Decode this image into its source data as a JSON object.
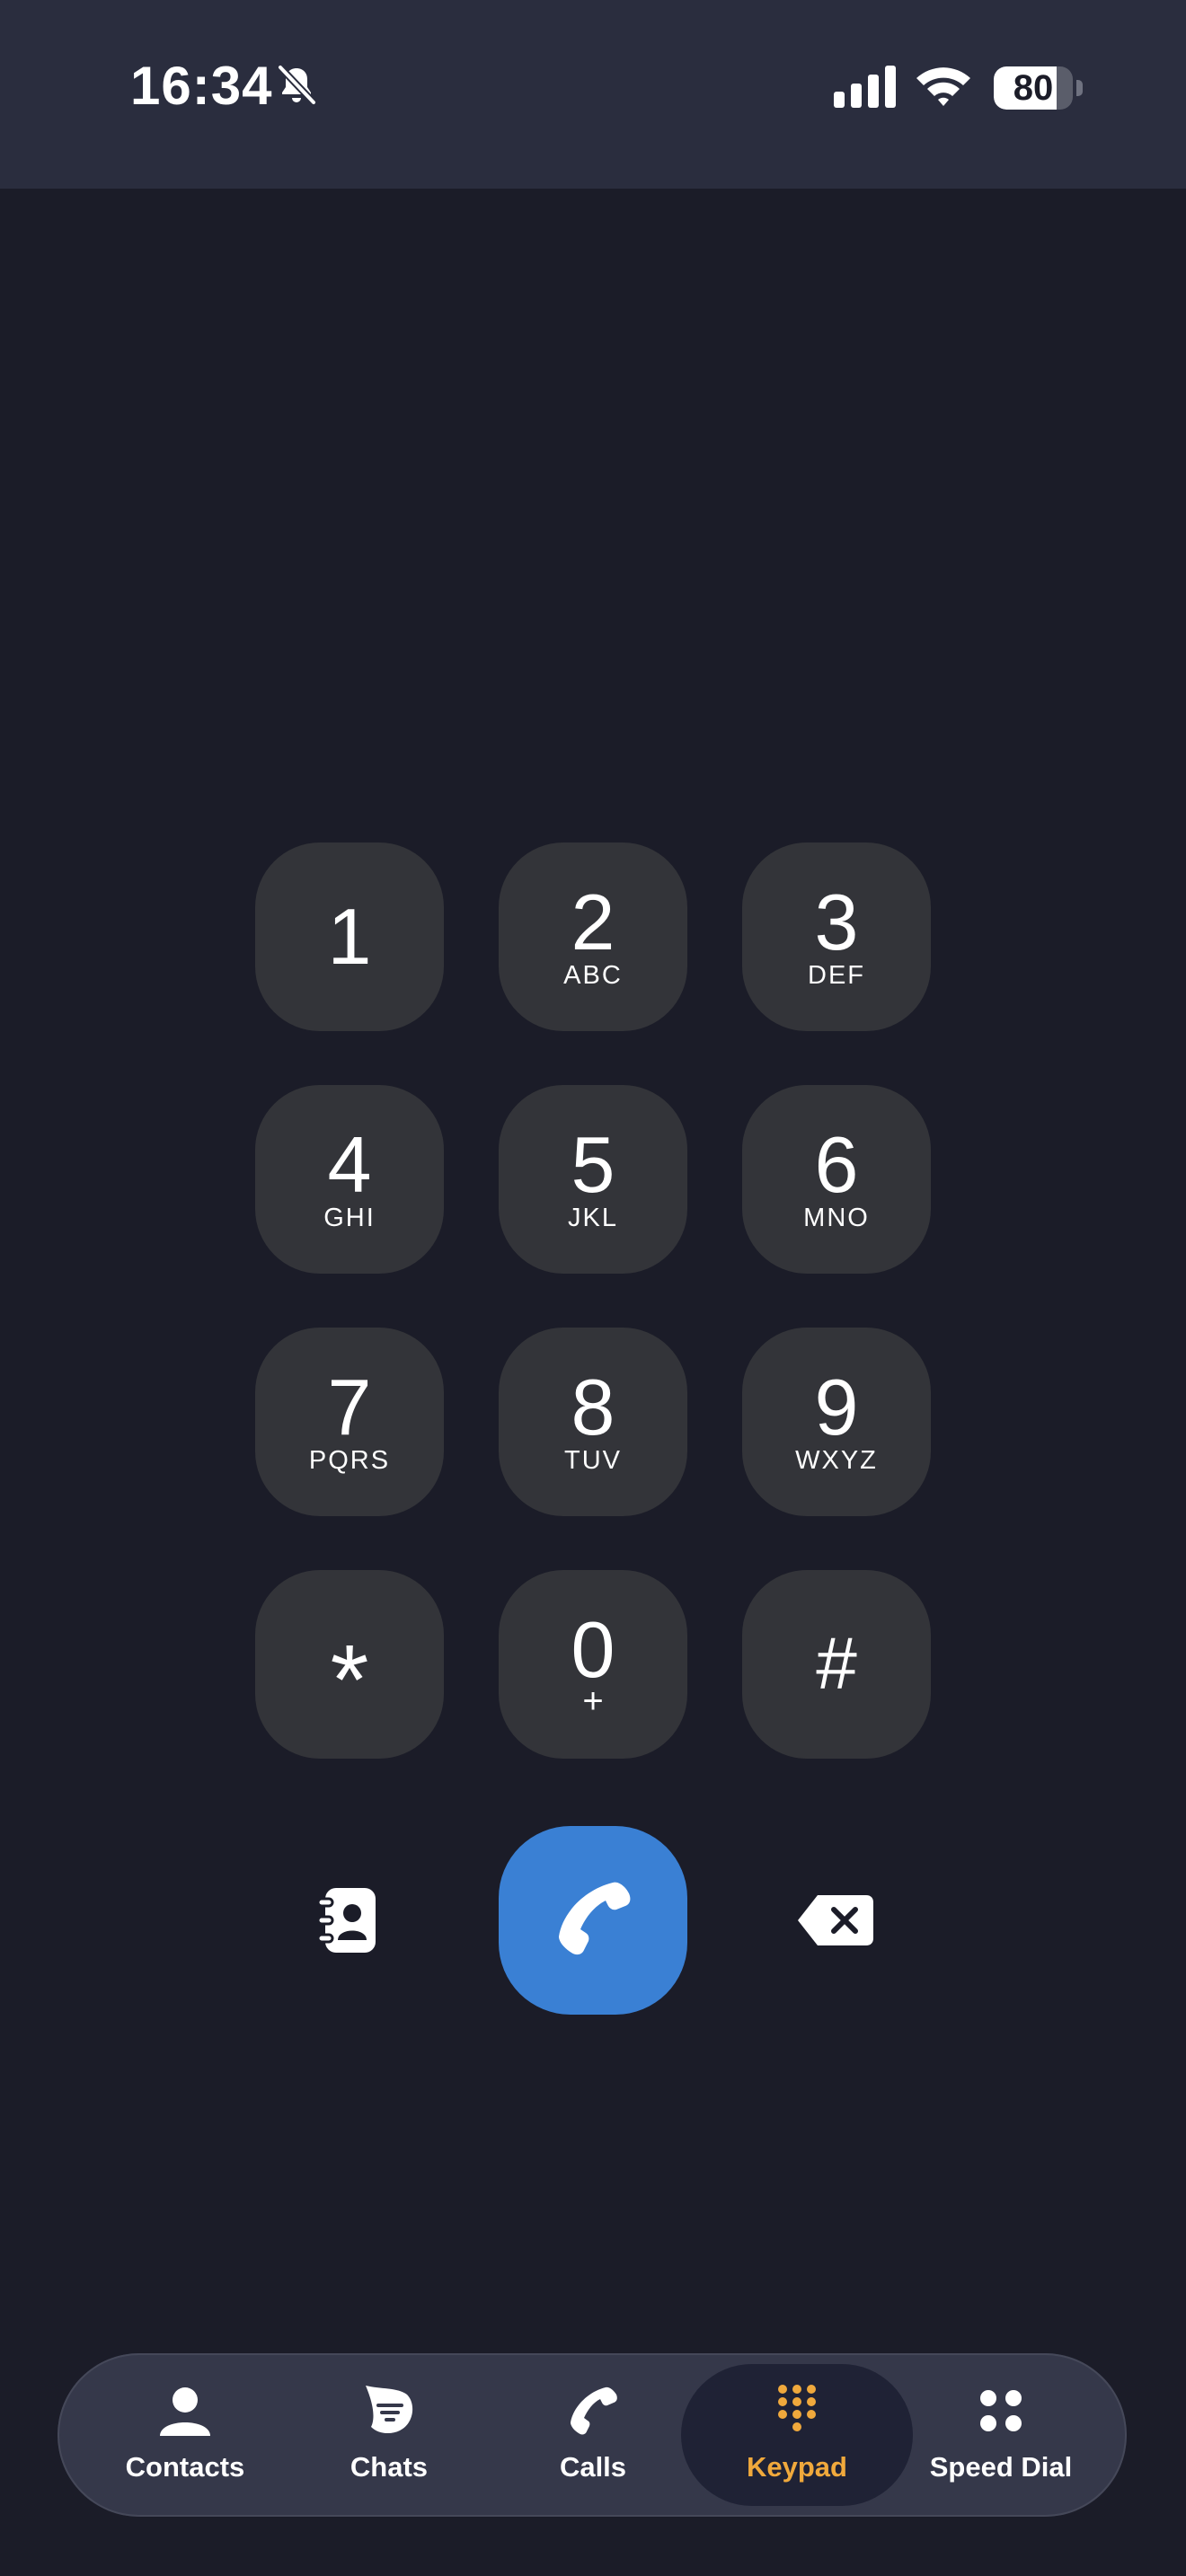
{
  "status_bar": {
    "time": "16:34",
    "battery_level": 80,
    "battery_label": "80"
  },
  "keypad": {
    "keys": [
      {
        "digit": "1",
        "letters": ""
      },
      {
        "digit": "2",
        "letters": "ABC"
      },
      {
        "digit": "3",
        "letters": "DEF"
      },
      {
        "digit": "4",
        "letters": "GHI"
      },
      {
        "digit": "5",
        "letters": "JKL"
      },
      {
        "digit": "6",
        "letters": "MNO"
      },
      {
        "digit": "7",
        "letters": "PQRS"
      },
      {
        "digit": "8",
        "letters": "TUV"
      },
      {
        "digit": "9",
        "letters": "WXYZ"
      },
      {
        "digit": "*",
        "letters": ""
      },
      {
        "digit": "0",
        "letters": "+"
      },
      {
        "digit": "#",
        "letters": ""
      }
    ]
  },
  "actions": {
    "left_icon": "contacts-book-icon",
    "call_icon": "phone-icon",
    "right_icon": "backspace-icon"
  },
  "tab_bar": {
    "active_tab": "Keypad",
    "items": [
      {
        "label": "Contacts",
        "icon": "person-icon"
      },
      {
        "label": "Chats",
        "icon": "chat-bubble-icon"
      },
      {
        "label": "Calls",
        "icon": "phone-icon"
      },
      {
        "label": "Keypad",
        "icon": "keypad-icon"
      },
      {
        "label": "Speed Dial",
        "icon": "four-dots-icon"
      }
    ]
  },
  "colors": {
    "background": "#1b1c28",
    "status_bar": "#2a2d3e",
    "key": "#333439",
    "call_button": "#3a80d4",
    "tab_bar": "#35384a",
    "tab_active_bg": "#1f2235",
    "accent": "#f0a93c"
  }
}
